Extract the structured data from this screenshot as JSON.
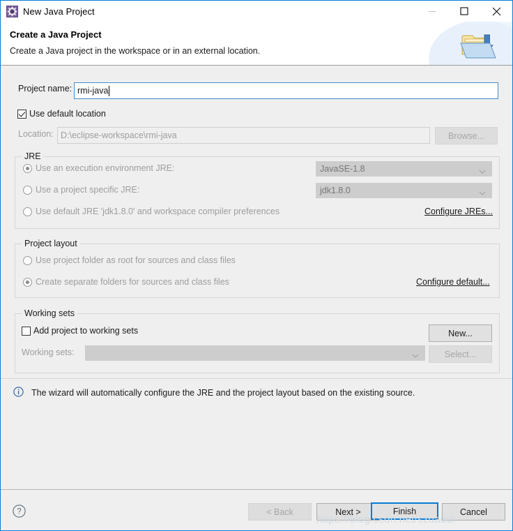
{
  "window": {
    "title": "New Java Project",
    "icon": "eclipse-wizard-icon",
    "minimize_label": "—",
    "maximize_label": "□",
    "close_label": "✕"
  },
  "header": {
    "title": "Create a Java Project",
    "subtitle": "Create a Java project in the workspace or in an external location.",
    "banner_icon": "new-java-project-folder-icon"
  },
  "form": {
    "project_name_label": "Project name:",
    "project_name_value": "rmi-java",
    "use_default_location_label": "Use default location",
    "use_default_location_checked": true,
    "location_label": "Location:",
    "location_value": "D:\\eclipse-workspace\\rmi-java",
    "browse_label": "Browse..."
  },
  "jre": {
    "group_title": "JRE",
    "option_exec_env_label": "Use an execution environment JRE:",
    "option_exec_env_selected": true,
    "exec_env_value": "JavaSE-1.8",
    "option_project_jre_label": "Use a project specific JRE:",
    "option_project_jre_selected": false,
    "project_jre_value": "jdk1.8.0",
    "option_default_jre_label": "Use default JRE 'jdk1.8.0' and workspace compiler preferences",
    "option_default_jre_selected": false,
    "configure_link": "Configure JREs..."
  },
  "project_layout": {
    "group_title": "Project layout",
    "option_root_label": "Use project folder as root for sources and class files",
    "option_root_selected": false,
    "option_separate_label": "Create separate folders for sources and class files",
    "option_separate_selected": true,
    "configure_link": "Configure default..."
  },
  "working_sets": {
    "group_title": "Working sets",
    "add_checkbox_label": "Add project to working sets",
    "add_checkbox_checked": false,
    "new_button_label": "New...",
    "working_sets_label": "Working sets:",
    "working_sets_value": "",
    "select_button_label": "Select..."
  },
  "status": {
    "icon": "info-icon",
    "message": "The wizard will automatically configure the JRE and the project layout based on the existing source."
  },
  "footer": {
    "help_icon": "help-question-icon",
    "back_label": "< Back",
    "back_disabled": true,
    "next_label": "Next >",
    "finish_label": "Finish",
    "finish_is_default": true,
    "cancel_label": "Cancel"
  },
  "watermark": {
    "text": "https://blog.csdn.net/szuaudi"
  },
  "colors": {
    "accent": "#0a7bd4",
    "dialog_bg": "#efefef",
    "white": "#ffffff",
    "disabled_text": "#9d9d9d",
    "border": "#d6d6d6"
  }
}
